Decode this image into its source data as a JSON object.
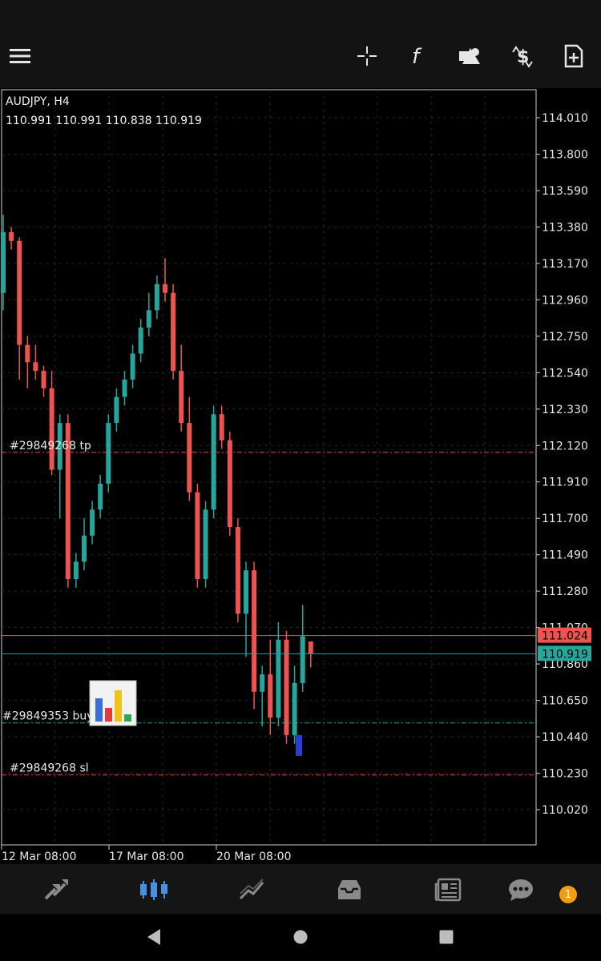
{
  "toolbar": {
    "menu": "menu-icon",
    "crosshair": "crosshair-icon",
    "indicators": "function-icon",
    "objects": "shapes-icon",
    "trade": "dollar-cycle-icon",
    "new_order": "add-document-icon"
  },
  "chart": {
    "symbol": "AUDJPY, H4",
    "ohlc": "110.991 110.991 110.838 110.919"
  },
  "chart_data": {
    "type": "candlestick",
    "price_axis": [
      "114.010",
      "113.800",
      "113.590",
      "113.380",
      "113.170",
      "112.960",
      "112.750",
      "112.540",
      "112.330",
      "112.120",
      "111.910",
      "111.700",
      "111.490",
      "111.280",
      "111.070",
      "110.860",
      "110.650",
      "110.440",
      "110.230",
      "110.020"
    ],
    "price_axis_values": [
      114.01,
      113.8,
      113.59,
      113.38,
      113.17,
      112.96,
      112.75,
      112.54,
      112.33,
      112.12,
      111.91,
      111.7,
      111.49,
      111.28,
      111.07,
      110.86,
      110.65,
      110.44,
      110.23,
      110.02
    ],
    "time_axis": [
      "12 Mar 08:00",
      "17 Mar 08:00",
      "20 Mar 08:00"
    ],
    "current_ask": "111.024",
    "current_bid": "110.919",
    "ask_value": 111.024,
    "bid_value": 110.919,
    "levels": [
      {
        "label": "#29849268 tp",
        "value": 112.08,
        "color": "#e74c3c"
      },
      {
        "label": "#29849353 buy,",
        "value": 110.52,
        "color": "#26a69a"
      },
      {
        "label": "#29849268 sl",
        "value": 110.22,
        "color": "#e74c3c"
      }
    ],
    "colors": {
      "up": "#26a69a",
      "down": "#ef5350",
      "grid": "#2a2a2a"
    },
    "candles": [
      {
        "o": 113.0,
        "h": 113.45,
        "l": 112.9,
        "c": 113.35
      },
      {
        "o": 113.35,
        "h": 113.38,
        "l": 113.25,
        "c": 113.3
      },
      {
        "o": 113.3,
        "h": 113.32,
        "l": 112.5,
        "c": 112.7
      },
      {
        "o": 112.7,
        "h": 112.75,
        "l": 112.45,
        "c": 112.6
      },
      {
        "o": 112.6,
        "h": 112.7,
        "l": 112.5,
        "c": 112.55
      },
      {
        "o": 112.55,
        "h": 112.58,
        "l": 112.4,
        "c": 112.45
      },
      {
        "o": 112.45,
        "h": 112.55,
        "l": 111.95,
        "c": 111.98
      },
      {
        "o": 111.98,
        "h": 112.3,
        "l": 111.7,
        "c": 112.25
      },
      {
        "o": 112.25,
        "h": 112.3,
        "l": 111.3,
        "c": 111.35
      },
      {
        "o": 111.35,
        "h": 111.5,
        "l": 111.3,
        "c": 111.45
      },
      {
        "o": 111.45,
        "h": 111.7,
        "l": 111.4,
        "c": 111.6
      },
      {
        "o": 111.6,
        "h": 111.8,
        "l": 111.55,
        "c": 111.75
      },
      {
        "o": 111.75,
        "h": 111.95,
        "l": 111.7,
        "c": 111.9
      },
      {
        "o": 111.9,
        "h": 112.3,
        "l": 111.85,
        "c": 112.25
      },
      {
        "o": 112.25,
        "h": 112.45,
        "l": 112.2,
        "c": 112.4
      },
      {
        "o": 112.4,
        "h": 112.55,
        "l": 112.35,
        "c": 112.5
      },
      {
        "o": 112.5,
        "h": 112.7,
        "l": 112.45,
        "c": 112.65
      },
      {
        "o": 112.65,
        "h": 112.85,
        "l": 112.6,
        "c": 112.8
      },
      {
        "o": 112.8,
        "h": 113.0,
        "l": 112.75,
        "c": 112.9
      },
      {
        "o": 112.9,
        "h": 113.1,
        "l": 112.85,
        "c": 113.05
      },
      {
        "o": 113.05,
        "h": 113.2,
        "l": 112.95,
        "c": 113.0
      },
      {
        "o": 113.0,
        "h": 113.05,
        "l": 112.5,
        "c": 112.55
      },
      {
        "o": 112.55,
        "h": 112.7,
        "l": 112.2,
        "c": 112.25
      },
      {
        "o": 112.25,
        "h": 112.4,
        "l": 111.8,
        "c": 111.85
      },
      {
        "o": 111.85,
        "h": 111.9,
        "l": 111.3,
        "c": 111.35
      },
      {
        "o": 111.35,
        "h": 111.8,
        "l": 111.3,
        "c": 111.75
      },
      {
        "o": 111.75,
        "h": 112.35,
        "l": 111.7,
        "c": 112.3
      },
      {
        "o": 112.3,
        "h": 112.35,
        "l": 112.1,
        "c": 112.15
      },
      {
        "o": 112.15,
        "h": 112.2,
        "l": 111.6,
        "c": 111.65
      },
      {
        "o": 111.65,
        "h": 111.7,
        "l": 111.1,
        "c": 111.15
      },
      {
        "o": 111.15,
        "h": 111.45,
        "l": 110.9,
        "c": 111.4
      },
      {
        "o": 111.4,
        "h": 111.45,
        "l": 110.6,
        "c": 110.7
      },
      {
        "o": 110.7,
        "h": 110.85,
        "l": 110.5,
        "c": 110.8
      },
      {
        "o": 110.8,
        "h": 111.0,
        "l": 110.45,
        "c": 110.55
      },
      {
        "o": 110.55,
        "h": 111.1,
        "l": 110.5,
        "c": 111.0
      },
      {
        "o": 111.0,
        "h": 111.05,
        "l": 110.4,
        "c": 110.45
      },
      {
        "o": 110.45,
        "h": 110.85,
        "l": 110.4,
        "c": 110.75
      },
      {
        "o": 110.75,
        "h": 111.2,
        "l": 110.7,
        "c": 111.02
      },
      {
        "o": 110.99,
        "h": 110.99,
        "l": 110.84,
        "c": 110.92
      }
    ]
  },
  "nav": {
    "trade": "trade-arrows-icon",
    "chart": "candles-icon",
    "history": "history-chart-icon",
    "inbox": "inbox-icon",
    "news": "news-icon",
    "chat": "chat-icon",
    "chat_badge": "1"
  },
  "system": {
    "back": "back-icon",
    "home": "home-icon",
    "recents": "recents-icon"
  }
}
